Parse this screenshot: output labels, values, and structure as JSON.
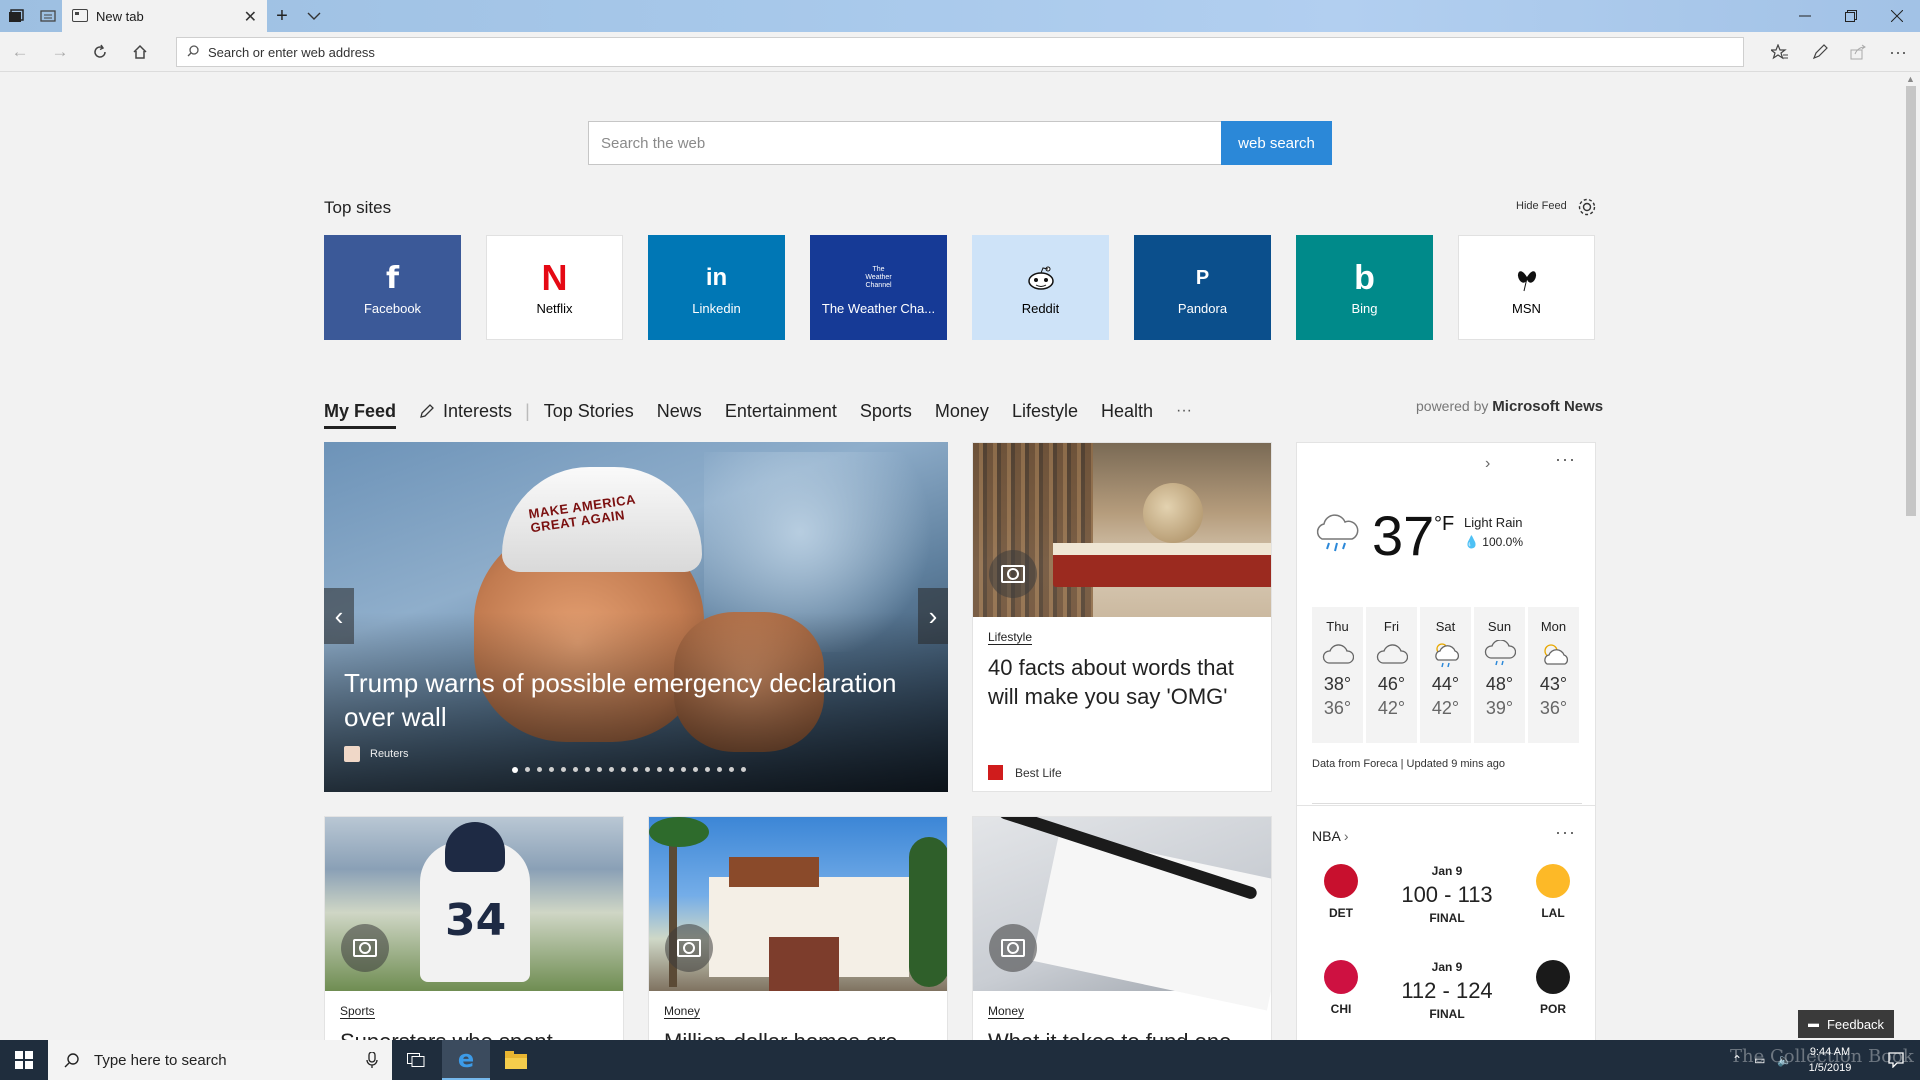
{
  "browser": {
    "tab_title": "New tab",
    "address_placeholder": "Search or enter web address"
  },
  "search": {
    "placeholder": "Search the web",
    "button_label": "web search"
  },
  "top_sites": {
    "title": "Top sites",
    "hide_feed": "Hide Feed",
    "tiles": [
      {
        "label": "Facebook",
        "icon": "facebook-logo",
        "bg": "#3b5998",
        "fg": "#ffffff"
      },
      {
        "label": "Netflix",
        "icon": "netflix-logo",
        "bg": "#ffffff",
        "fg": "#000000"
      },
      {
        "label": "Linkedin",
        "icon": "linkedin-logo",
        "bg": "#0077b5",
        "fg": "#ffffff"
      },
      {
        "label": "The Weather Cha...",
        "icon": "weather-channel-logo",
        "bg": "#163a96",
        "fg": "#ffffff"
      },
      {
        "label": "Reddit",
        "icon": "reddit-logo",
        "bg": "#cee3f8",
        "fg": "#000000"
      },
      {
        "label": "Pandora",
        "icon": "pandora-logo",
        "bg": "#0b4f8c",
        "fg": "#ffffff"
      },
      {
        "label": "Bing",
        "icon": "bing-logo",
        "bg": "#008a8a",
        "fg": "#ffffff"
      },
      {
        "label": "MSN",
        "icon": "msn-logo",
        "bg": "#ffffff",
        "fg": "#000000"
      }
    ]
  },
  "feed_nav": {
    "items": [
      "My Feed",
      "Interests",
      "Top Stories",
      "News",
      "Entertainment",
      "Sports",
      "Money",
      "Lifestyle",
      "Health",
      "···"
    ],
    "powered_prefix": "powered by",
    "powered_brand": "Microsoft News"
  },
  "hero": {
    "headline": "Trump warns of possible emergency declaration over wall",
    "source": "Reuters",
    "cap_text": "MAKE AMERICA GREAT AGAIN"
  },
  "articles": [
    {
      "category": "Lifestyle",
      "title": "40 facts about words that will make you say 'OMG'",
      "source": "Best Life"
    },
    {
      "category": "Sports",
      "title": "Superstars who spent..."
    },
    {
      "category": "Money",
      "title": "Million-dollar homes are..."
    },
    {
      "category": "Money",
      "title": "What it takes to fund one..."
    }
  ],
  "weather": {
    "temp": "37",
    "unit": "°F",
    "condition": "Light Rain",
    "precip": "100.0%",
    "forecast": [
      {
        "day": "Thu",
        "hi": "38°",
        "lo": "36°",
        "icon": "cloudy"
      },
      {
        "day": "Fri",
        "hi": "46°",
        "lo": "42°",
        "icon": "cloudy"
      },
      {
        "day": "Sat",
        "hi": "44°",
        "lo": "42°",
        "icon": "sun-rain"
      },
      {
        "day": "Sun",
        "hi": "48°",
        "lo": "39°",
        "icon": "rain"
      },
      {
        "day": "Mon",
        "hi": "43°",
        "lo": "36°",
        "icon": "partly-sunny"
      }
    ],
    "source": "Data from Foreca | Updated 9 mins ago"
  },
  "nba": {
    "title": "NBA",
    "games": [
      {
        "date": "Jan 9",
        "score": "100 - 113",
        "status": "FINAL",
        "home": "DET",
        "away": "LAL",
        "home_color": "#c8102e",
        "away_color": "#fdb927"
      },
      {
        "date": "Jan 9",
        "score": "112 - 124",
        "status": "FINAL",
        "home": "CHI",
        "away": "POR",
        "home_color": "#ce1141",
        "away_color": "#1a1a1a"
      }
    ]
  },
  "feedback": "Feedback",
  "taskbar": {
    "search_placeholder": "Type here to search",
    "time": "9:44 AM",
    "date": "1/5/2019"
  },
  "watermark": "The Collection Book"
}
